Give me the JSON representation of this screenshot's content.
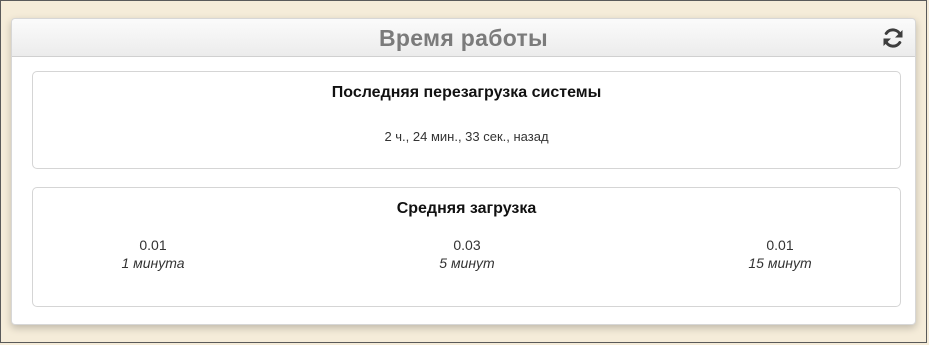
{
  "widget": {
    "title": "Время работы",
    "refresh_icon": "refresh-icon"
  },
  "reboot": {
    "title": "Последняя перезагрузка системы",
    "value": "2 ч., 24 мин., 33 сек., назад"
  },
  "load": {
    "title": "Средняя загрузка",
    "items": [
      {
        "value": "0.01",
        "label": "1 минута"
      },
      {
        "value": "0.03",
        "label": "5 минут"
      },
      {
        "value": "0.01",
        "label": "15 минут"
      }
    ]
  },
  "colors": {
    "background": "#f5ecd9",
    "title_text": "#7b7b7b",
    "panel_border": "#d5d5d5"
  }
}
